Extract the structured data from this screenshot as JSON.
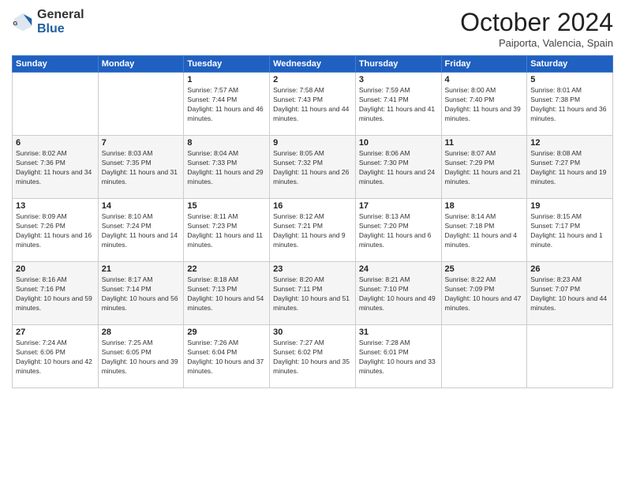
{
  "logo": {
    "general": "General",
    "blue": "Blue"
  },
  "header": {
    "month": "October 2024",
    "location": "Paiporta, Valencia, Spain"
  },
  "weekdays": [
    "Sunday",
    "Monday",
    "Tuesday",
    "Wednesday",
    "Thursday",
    "Friday",
    "Saturday"
  ],
  "weeks": [
    [
      {
        "day": "",
        "info": ""
      },
      {
        "day": "",
        "info": ""
      },
      {
        "day": "1",
        "info": "Sunrise: 7:57 AM\nSunset: 7:44 PM\nDaylight: 11 hours and 46 minutes."
      },
      {
        "day": "2",
        "info": "Sunrise: 7:58 AM\nSunset: 7:43 PM\nDaylight: 11 hours and 44 minutes."
      },
      {
        "day": "3",
        "info": "Sunrise: 7:59 AM\nSunset: 7:41 PM\nDaylight: 11 hours and 41 minutes."
      },
      {
        "day": "4",
        "info": "Sunrise: 8:00 AM\nSunset: 7:40 PM\nDaylight: 11 hours and 39 minutes."
      },
      {
        "day": "5",
        "info": "Sunrise: 8:01 AM\nSunset: 7:38 PM\nDaylight: 11 hours and 36 minutes."
      }
    ],
    [
      {
        "day": "6",
        "info": "Sunrise: 8:02 AM\nSunset: 7:36 PM\nDaylight: 11 hours and 34 minutes."
      },
      {
        "day": "7",
        "info": "Sunrise: 8:03 AM\nSunset: 7:35 PM\nDaylight: 11 hours and 31 minutes."
      },
      {
        "day": "8",
        "info": "Sunrise: 8:04 AM\nSunset: 7:33 PM\nDaylight: 11 hours and 29 minutes."
      },
      {
        "day": "9",
        "info": "Sunrise: 8:05 AM\nSunset: 7:32 PM\nDaylight: 11 hours and 26 minutes."
      },
      {
        "day": "10",
        "info": "Sunrise: 8:06 AM\nSunset: 7:30 PM\nDaylight: 11 hours and 24 minutes."
      },
      {
        "day": "11",
        "info": "Sunrise: 8:07 AM\nSunset: 7:29 PM\nDaylight: 11 hours and 21 minutes."
      },
      {
        "day": "12",
        "info": "Sunrise: 8:08 AM\nSunset: 7:27 PM\nDaylight: 11 hours and 19 minutes."
      }
    ],
    [
      {
        "day": "13",
        "info": "Sunrise: 8:09 AM\nSunset: 7:26 PM\nDaylight: 11 hours and 16 minutes."
      },
      {
        "day": "14",
        "info": "Sunrise: 8:10 AM\nSunset: 7:24 PM\nDaylight: 11 hours and 14 minutes."
      },
      {
        "day": "15",
        "info": "Sunrise: 8:11 AM\nSunset: 7:23 PM\nDaylight: 11 hours and 11 minutes."
      },
      {
        "day": "16",
        "info": "Sunrise: 8:12 AM\nSunset: 7:21 PM\nDaylight: 11 hours and 9 minutes."
      },
      {
        "day": "17",
        "info": "Sunrise: 8:13 AM\nSunset: 7:20 PM\nDaylight: 11 hours and 6 minutes."
      },
      {
        "day": "18",
        "info": "Sunrise: 8:14 AM\nSunset: 7:18 PM\nDaylight: 11 hours and 4 minutes."
      },
      {
        "day": "19",
        "info": "Sunrise: 8:15 AM\nSunset: 7:17 PM\nDaylight: 11 hours and 1 minute."
      }
    ],
    [
      {
        "day": "20",
        "info": "Sunrise: 8:16 AM\nSunset: 7:16 PM\nDaylight: 10 hours and 59 minutes."
      },
      {
        "day": "21",
        "info": "Sunrise: 8:17 AM\nSunset: 7:14 PM\nDaylight: 10 hours and 56 minutes."
      },
      {
        "day": "22",
        "info": "Sunrise: 8:18 AM\nSunset: 7:13 PM\nDaylight: 10 hours and 54 minutes."
      },
      {
        "day": "23",
        "info": "Sunrise: 8:20 AM\nSunset: 7:11 PM\nDaylight: 10 hours and 51 minutes."
      },
      {
        "day": "24",
        "info": "Sunrise: 8:21 AM\nSunset: 7:10 PM\nDaylight: 10 hours and 49 minutes."
      },
      {
        "day": "25",
        "info": "Sunrise: 8:22 AM\nSunset: 7:09 PM\nDaylight: 10 hours and 47 minutes."
      },
      {
        "day": "26",
        "info": "Sunrise: 8:23 AM\nSunset: 7:07 PM\nDaylight: 10 hours and 44 minutes."
      }
    ],
    [
      {
        "day": "27",
        "info": "Sunrise: 7:24 AM\nSunset: 6:06 PM\nDaylight: 10 hours and 42 minutes."
      },
      {
        "day": "28",
        "info": "Sunrise: 7:25 AM\nSunset: 6:05 PM\nDaylight: 10 hours and 39 minutes."
      },
      {
        "day": "29",
        "info": "Sunrise: 7:26 AM\nSunset: 6:04 PM\nDaylight: 10 hours and 37 minutes."
      },
      {
        "day": "30",
        "info": "Sunrise: 7:27 AM\nSunset: 6:02 PM\nDaylight: 10 hours and 35 minutes."
      },
      {
        "day": "31",
        "info": "Sunrise: 7:28 AM\nSunset: 6:01 PM\nDaylight: 10 hours and 33 minutes."
      },
      {
        "day": "",
        "info": ""
      },
      {
        "day": "",
        "info": ""
      }
    ]
  ]
}
